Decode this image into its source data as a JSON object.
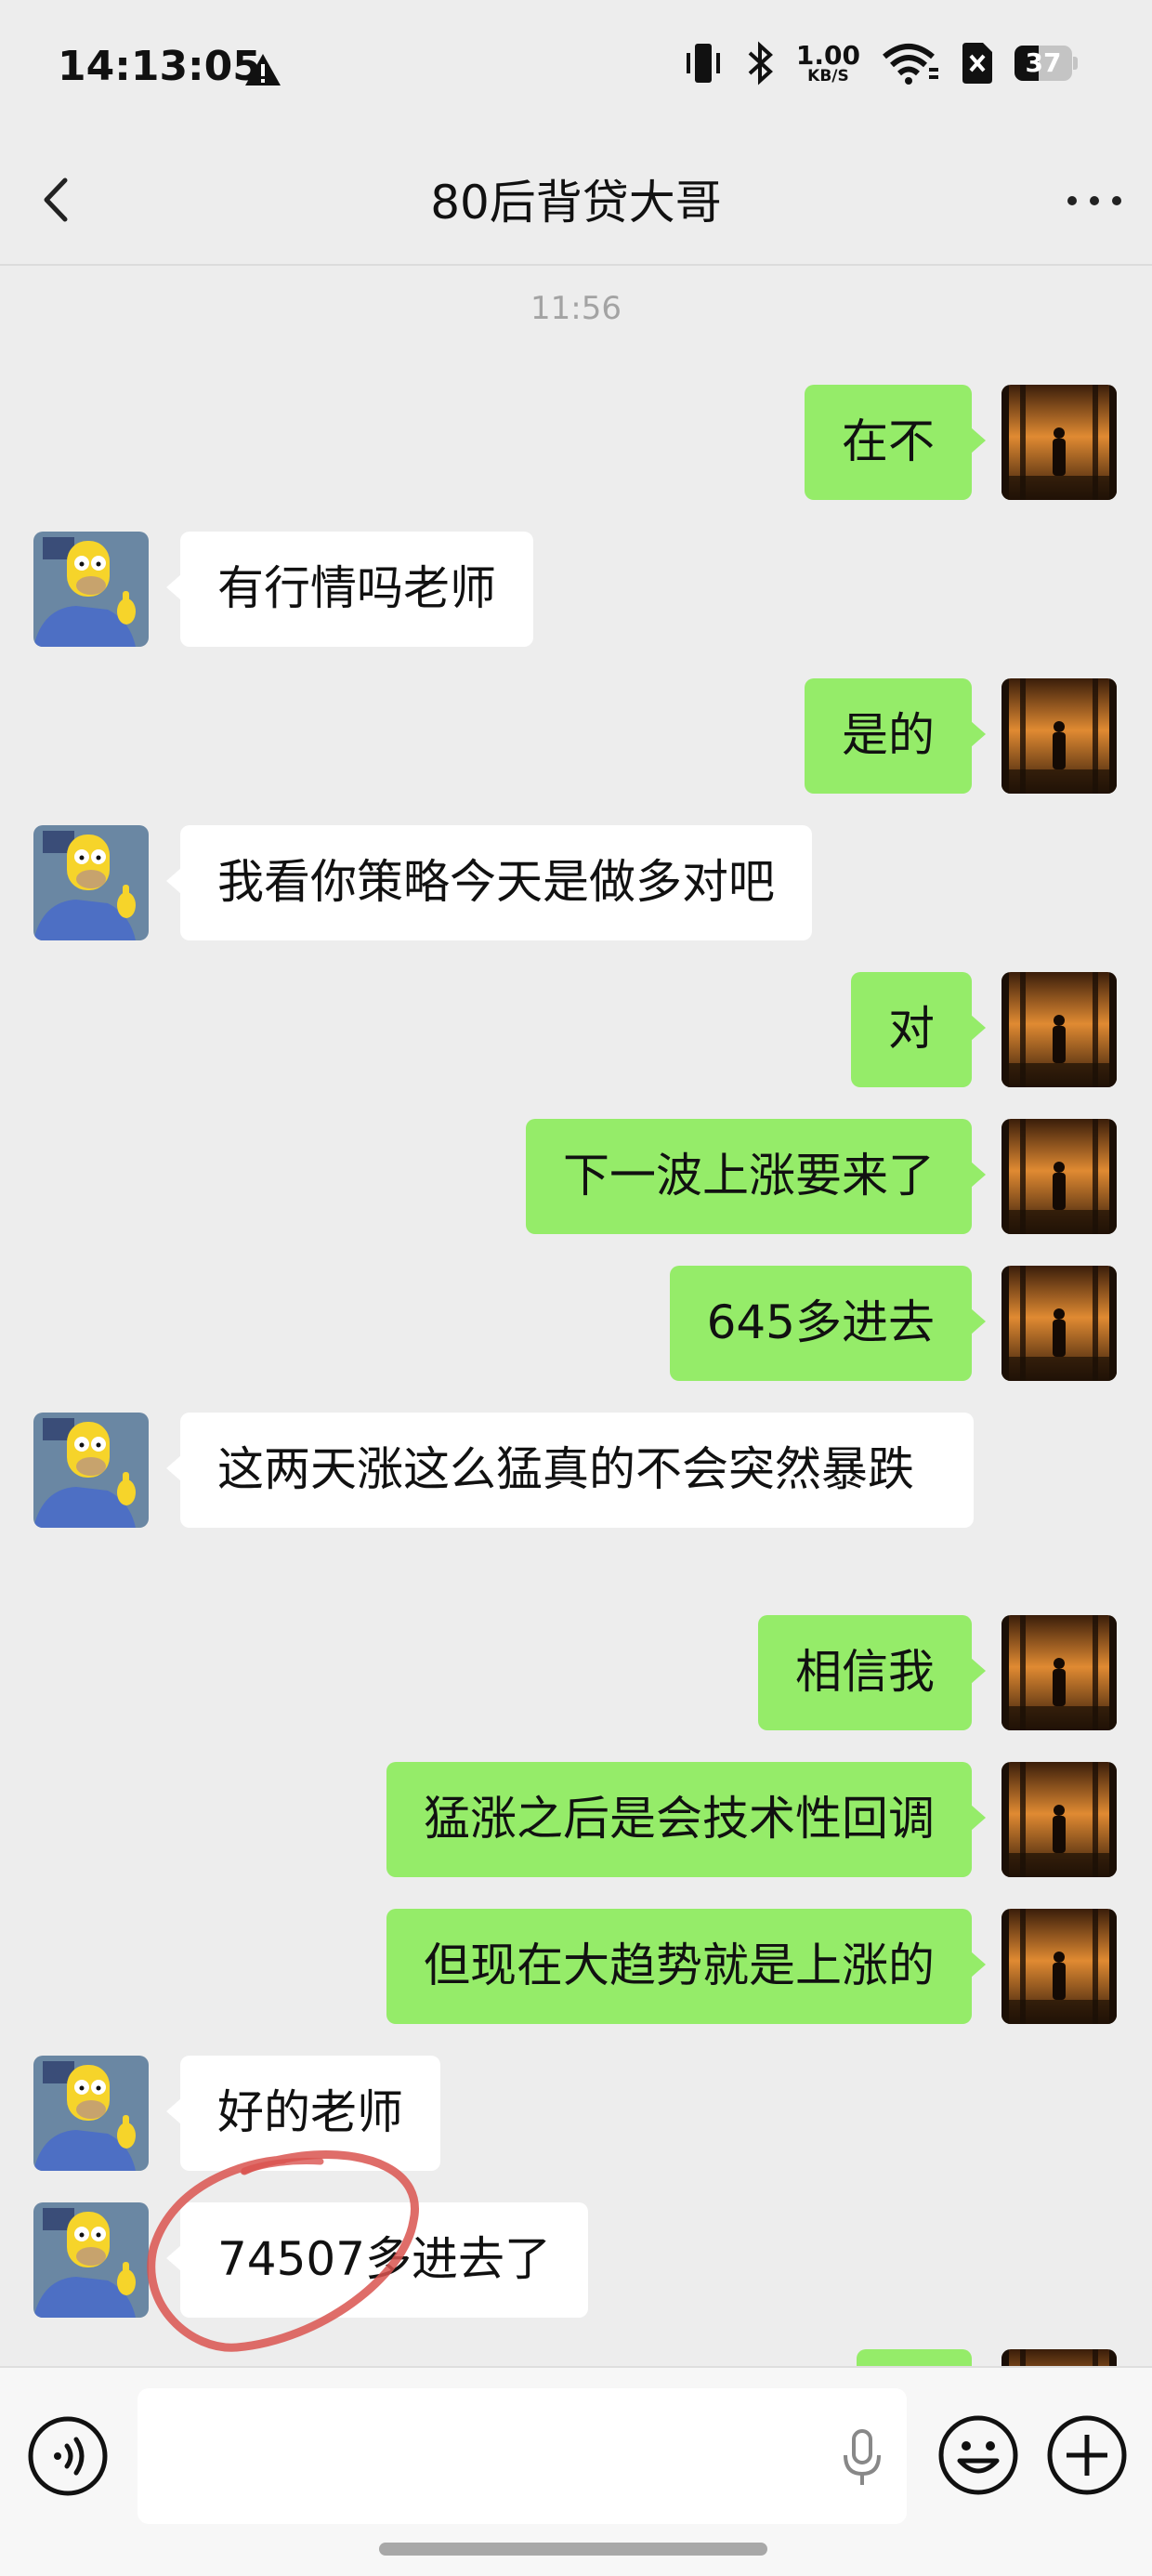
{
  "status_bar": {
    "time": "14:13:05",
    "net_speed": "1.00",
    "net_unit": "KB/S",
    "battery": "37"
  },
  "nav": {
    "title": "80后背贷大哥"
  },
  "chat": {
    "time_label": "11:56",
    "messages": [
      {
        "from": "self",
        "text": "在不"
      },
      {
        "from": "other",
        "text": "有行情吗老师"
      },
      {
        "from": "self",
        "text": "是的"
      },
      {
        "from": "other",
        "text": "我看你策略今天是做多对吧"
      },
      {
        "from": "self",
        "text": "对"
      },
      {
        "from": "self",
        "text": "下一波上涨要来了"
      },
      {
        "from": "self",
        "text": "645多进去"
      },
      {
        "from": "other",
        "text": "这两天涨这么猛真的不会突然暴跌"
      },
      {
        "from": "self",
        "text": "相信我"
      },
      {
        "from": "self",
        "text": "猛涨之后是会技术性回调"
      },
      {
        "from": "self",
        "text": "但现在大趋势就是上涨的"
      },
      {
        "from": "other",
        "text": "好的老师"
      },
      {
        "from": "other",
        "text": "74507多进去了"
      },
      {
        "from": "self",
        "text": ""
      }
    ]
  },
  "input": {
    "value": ""
  },
  "colors": {
    "self_bubble": "#95ec69",
    "other_bubble": "#ffffff",
    "background": "#ededed",
    "annotation": "#d9534f"
  },
  "icons": {
    "warning": "warning-icon",
    "vibrate": "vibrate-icon",
    "bluetooth": "bluetooth-icon",
    "wifi": "wifi-icon",
    "sim": "sim-icon",
    "battery": "battery-icon",
    "back": "chevron-left-icon",
    "more": "more-dots-icon",
    "voice": "voice-icon",
    "mic": "mic-icon",
    "emoji": "emoji-icon",
    "plus": "plus-icon"
  }
}
